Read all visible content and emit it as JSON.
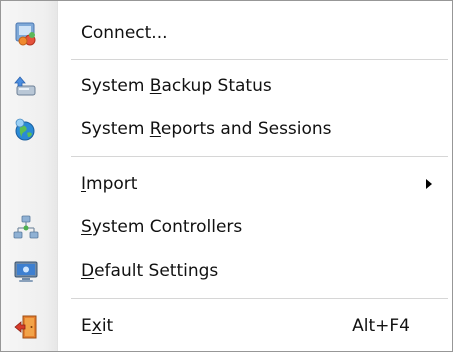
{
  "menu": {
    "connect": {
      "pre": "Connect...",
      "u": "",
      "post": ""
    },
    "backup": {
      "pre": "System ",
      "u": "B",
      "post": "ackup Status"
    },
    "reports": {
      "pre": "System ",
      "u": "R",
      "post": "eports and Sessions"
    },
    "import": {
      "pre": "",
      "u": "I",
      "post": "mport",
      "submenu": true
    },
    "controllers": {
      "pre": "",
      "u": "S",
      "post": "ystem Controllers"
    },
    "defaults": {
      "pre": "",
      "u": "D",
      "post": "efault Settings"
    },
    "exit": {
      "pre": "E",
      "u": "x",
      "post": "it",
      "shortcut": "Alt+F4"
    }
  },
  "icons": {
    "connect": "connect-icon",
    "backup": "backup-status-icon",
    "reports": "reports-sessions-icon",
    "controllers": "network-controllers-icon",
    "defaults": "monitor-settings-icon",
    "exit": "exit-door-icon"
  }
}
